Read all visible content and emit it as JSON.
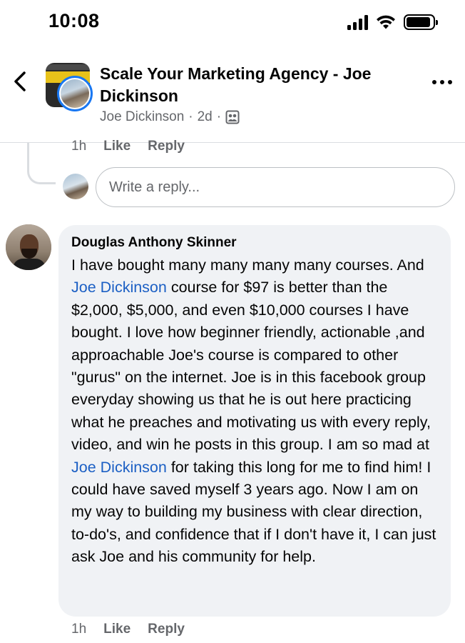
{
  "status_bar": {
    "time": "10:08"
  },
  "header": {
    "group_title": "Scale Your Marketing Agency - Joe Dickinson",
    "author": "Joe Dickinson",
    "separator": "·",
    "age": "2d",
    "back_icon": "chevron-left-icon",
    "more_icon": "more-horizontal-icon",
    "privacy_icon": "group-members-icon"
  },
  "previous_comment": {
    "time": "1h",
    "like_label": "Like",
    "reply_label": "Reply"
  },
  "reply_box": {
    "placeholder": "Write a reply..."
  },
  "comment": {
    "author": "Douglas Anthony Skinner",
    "text_1": "I have bought many many many many courses. And ",
    "mention_1": "Joe Dickinson",
    "text_2": " course for $97 is better than the $2,000, $5,000, and even $10,000 courses I have bought. I love how beginner friendly, actionable ,and approachable Joe's course is compared to other \"gurus\" on the internet. Joe is in this facebook group everyday showing us that he is out here practicing what he preaches and motivating us with every reply, video, and win he posts in this group. I am so mad at ",
    "mention_2": "Joe Dickinson",
    "text_3": " for taking this long for me to find him! I could have saved myself 3 years ago. Now I am on my way to building my business with clear direction, to-do's, and confidence that if I don't have it, I can just ask Joe and his community for help.",
    "time": "1h",
    "like_label": "Like",
    "reply_label": "Reply"
  },
  "colors": {
    "mention": "#1b5fc4",
    "badge_ring": "#1877f2",
    "bubble": "#f0f2f5",
    "secondary_text": "#65676b"
  }
}
